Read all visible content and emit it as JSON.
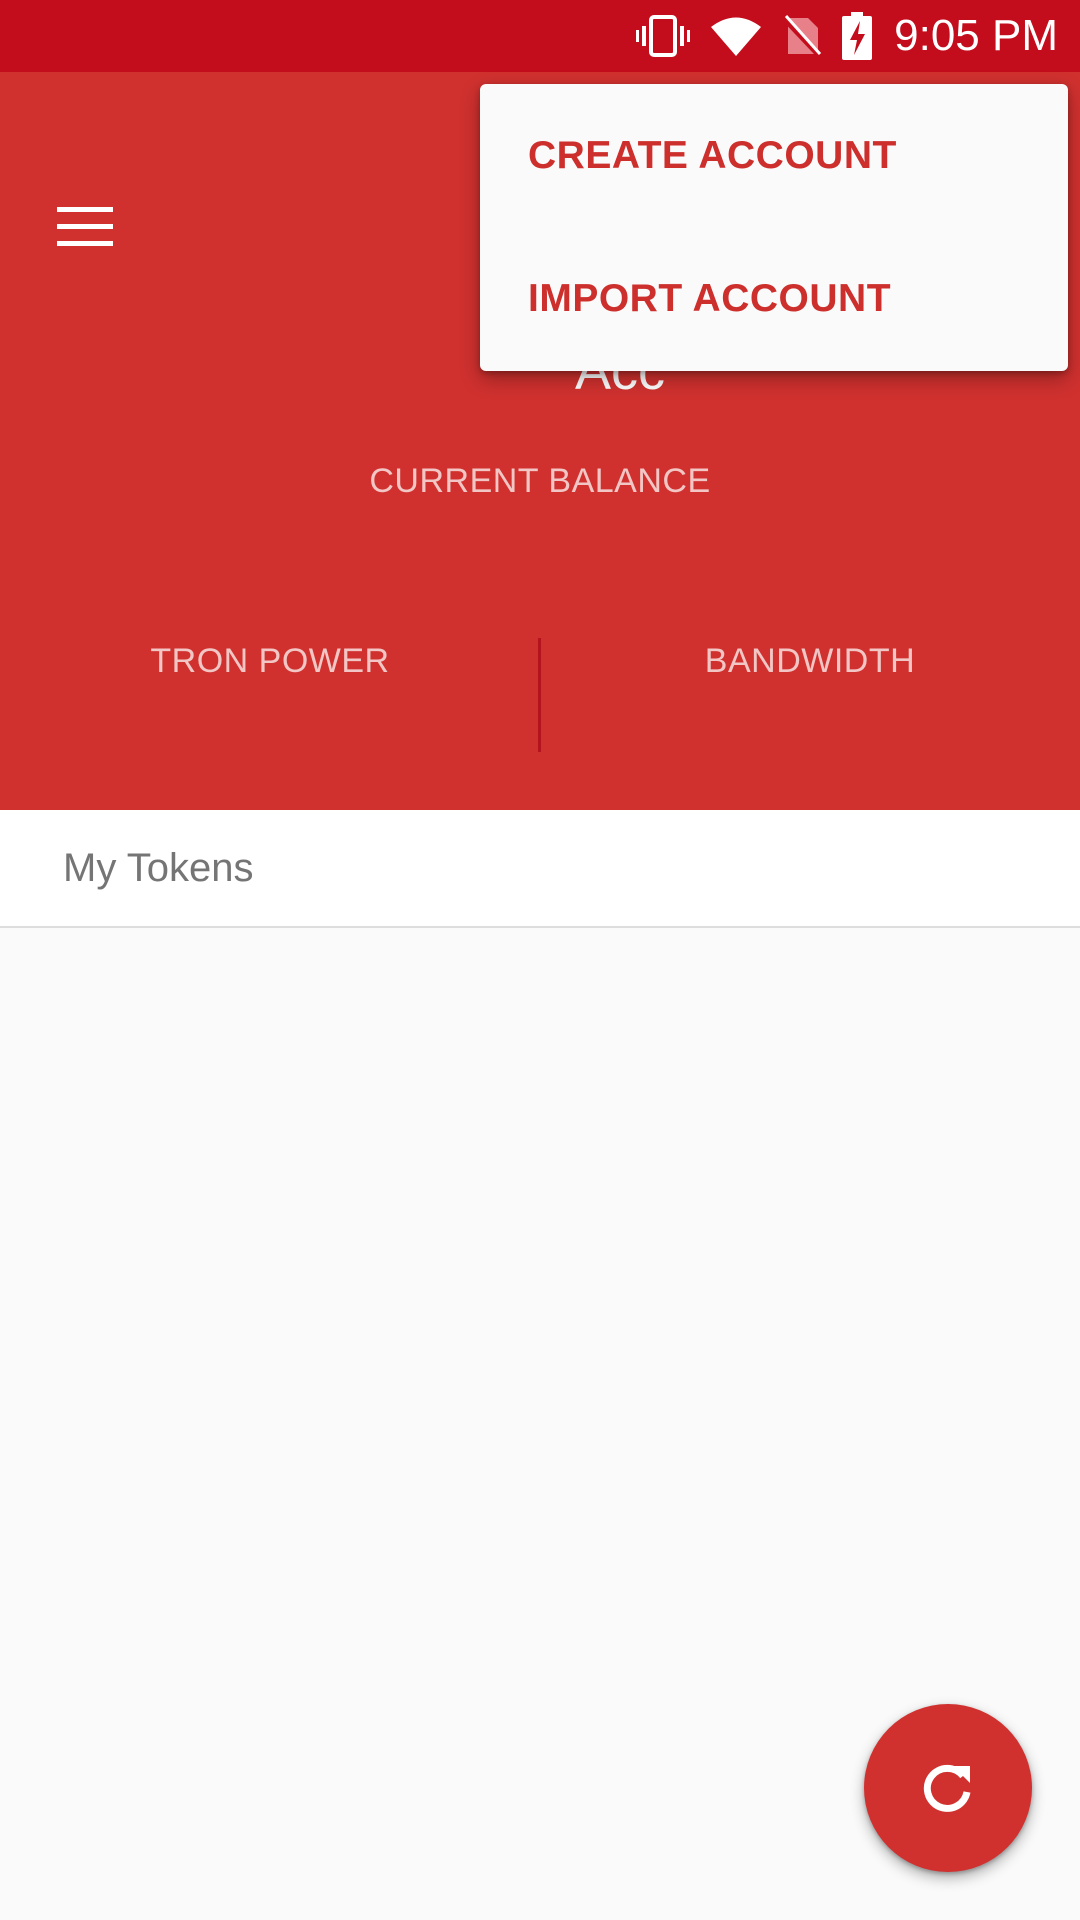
{
  "status_bar": {
    "time": "9:05 PM",
    "icons": [
      "vibrate-icon",
      "wifi-icon",
      "no-sim-icon",
      "battery-charging-icon"
    ],
    "background": "#c30d1c"
  },
  "header": {
    "menu_icon": "hamburger-menu-icon",
    "title": "Acc",
    "balance_label": "CURRENT BALANCE",
    "stats": {
      "tron_power_label": "TRON POWER",
      "bandwidth_label": "BANDWIDTH"
    },
    "background": "#d0312f"
  },
  "tokens": {
    "title": "My Tokens"
  },
  "overflow_menu": {
    "items": [
      {
        "label": "CREATE ACCOUNT"
      },
      {
        "label": "IMPORT ACCOUNT"
      }
    ],
    "accent": "#cc2f2c"
  },
  "fab": {
    "icon": "refresh-icon"
  }
}
